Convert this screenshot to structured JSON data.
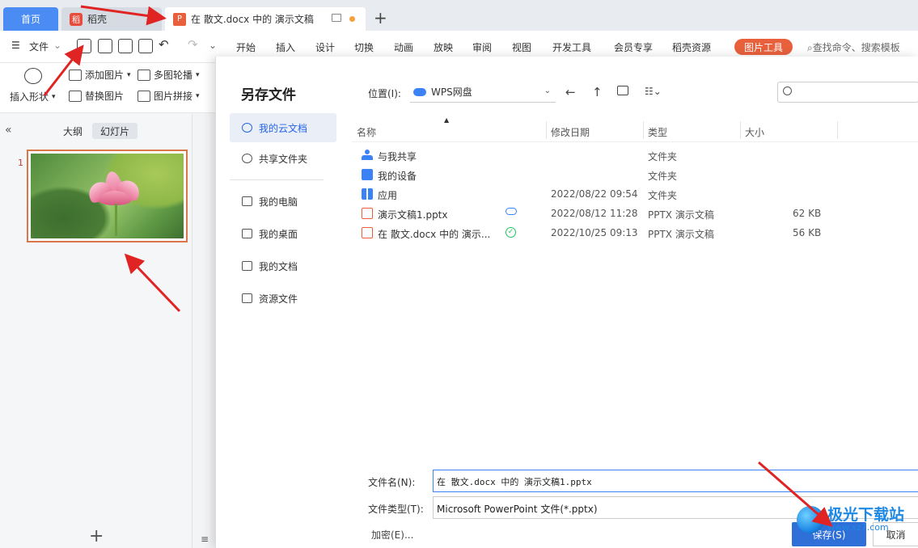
{
  "tabs": {
    "home": "首页",
    "daoke": "稻壳",
    "doc": "在 散文.docx 中的 演示文稿"
  },
  "toolbar": {
    "file": "文件",
    "menu": [
      "开始",
      "插入",
      "设计",
      "切换",
      "动画",
      "放映",
      "审阅",
      "视图",
      "开发工具",
      "会员专享",
      "稻壳资源"
    ],
    "picture_tools": "图片工具",
    "search_placeholder": "查找命令、搜索模板"
  },
  "ribbon": {
    "insert_shape": "插入形状",
    "add_picture": "添加图片",
    "multi_carousel": "多图轮播",
    "replace_picture": "替换图片",
    "picture_collage": "图片拼接"
  },
  "left_panel": {
    "tab_outline": "大纲",
    "tab_slides": "幻灯片",
    "slide_number": "1"
  },
  "dialog": {
    "title": "另存文件",
    "location_label": "位置(I):",
    "location_value": "WPS网盘",
    "sidebar": [
      {
        "label": "我的云文档",
        "active": true
      },
      {
        "label": "共享文件夹",
        "active": false
      },
      {
        "label": "我的电脑",
        "active": false
      },
      {
        "label": "我的桌面",
        "active": false
      },
      {
        "label": "我的文档",
        "active": false
      },
      {
        "label": "资源文件",
        "active": false
      }
    ],
    "columns": [
      "名称",
      "修改日期",
      "类型",
      "大小"
    ],
    "files": [
      {
        "name": "与我共享",
        "date": "",
        "type": "文件夹",
        "size": "",
        "icon": "share-icon",
        "status": ""
      },
      {
        "name": "我的设备",
        "date": "",
        "type": "文件夹",
        "size": "",
        "icon": "device-icon",
        "status": ""
      },
      {
        "name": "应用",
        "date": "2022/08/22 09:54",
        "type": "文件夹",
        "size": "",
        "icon": "apps-icon",
        "status": ""
      },
      {
        "name": "演示文稿1.pptx",
        "date": "2022/08/12 11:28",
        "type": "PPTX 演示文稿",
        "size": "62 KB",
        "icon": "pptx-icon",
        "status": "cloud"
      },
      {
        "name": "在 散文.docx 中的 演示...",
        "date": "2022/10/25 09:13",
        "type": "PPTX 演示文稿",
        "size": "56 KB",
        "icon": "pptx-icon",
        "status": "synced"
      }
    ],
    "filename_label": "文件名(N):",
    "filename_value": "在 散文.docx 中的 演示文稿1.pptx",
    "filetype_label": "文件类型(T):",
    "filetype_value": "Microsoft PowerPoint 文件(*.pptx)",
    "encrypt": "加密(E)...",
    "save": "保存(S)",
    "cancel": "取消"
  },
  "watermark": {
    "big": "极光下载站",
    "small": "www.xz7.com"
  },
  "colors": {
    "accent": "#2f6fd8",
    "brand_orange": "#e8603c",
    "annotation_red": "#e02424"
  }
}
